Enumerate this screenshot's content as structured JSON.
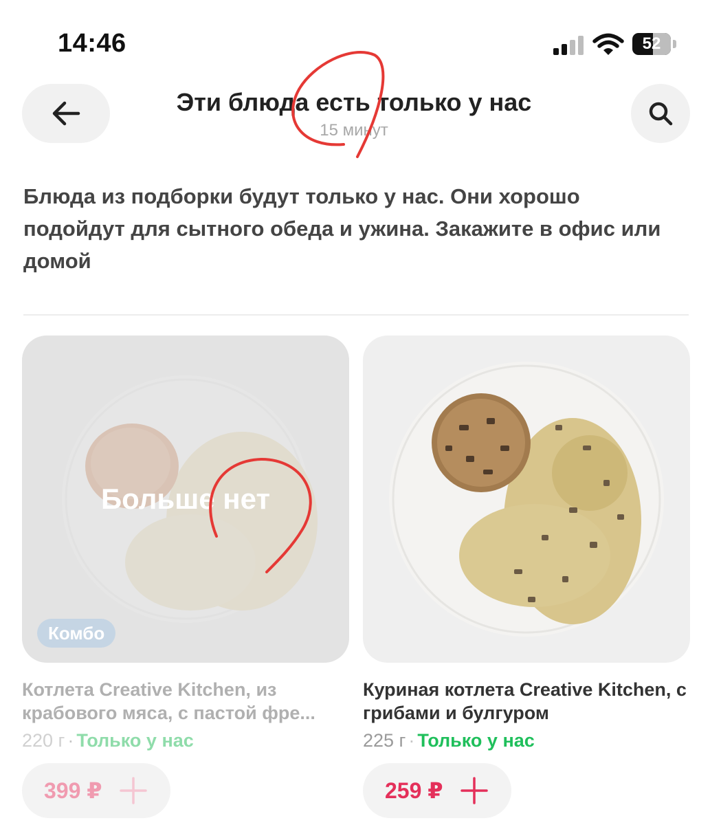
{
  "status_bar": {
    "time": "14:46",
    "battery": "52",
    "battery_level_percent": 52
  },
  "header": {
    "title": "Эти блюда есть только у нас",
    "subtitle": "15 минут"
  },
  "description": "Блюда из подборки будут только у нас. Они хорошо подойдут для сытного обеда и ужина. Закажите в офис или домой",
  "products": [
    {
      "name": "Котлета Creative Kitchen, из крабового мяса, с пастой фре...",
      "weight": "220 г",
      "exclusive": "Только у нас",
      "price": "399 ₽",
      "badge": "Комбо",
      "overlay": "Больше нет"
    },
    {
      "name": "Куриная котлета Creative Kitchen, с грибами и булгуром",
      "weight": "225 г",
      "exclusive": "Только у нас",
      "price": "259 ₽"
    }
  ],
  "colors": {
    "accent_price": "#e4305a",
    "exclusive_green": "#1fbf5b",
    "annotation_red": "#e53935"
  },
  "icons": [
    "signal-icon",
    "wifi-icon",
    "battery-icon",
    "back-arrow-icon",
    "search-icon",
    "plus-icon"
  ]
}
